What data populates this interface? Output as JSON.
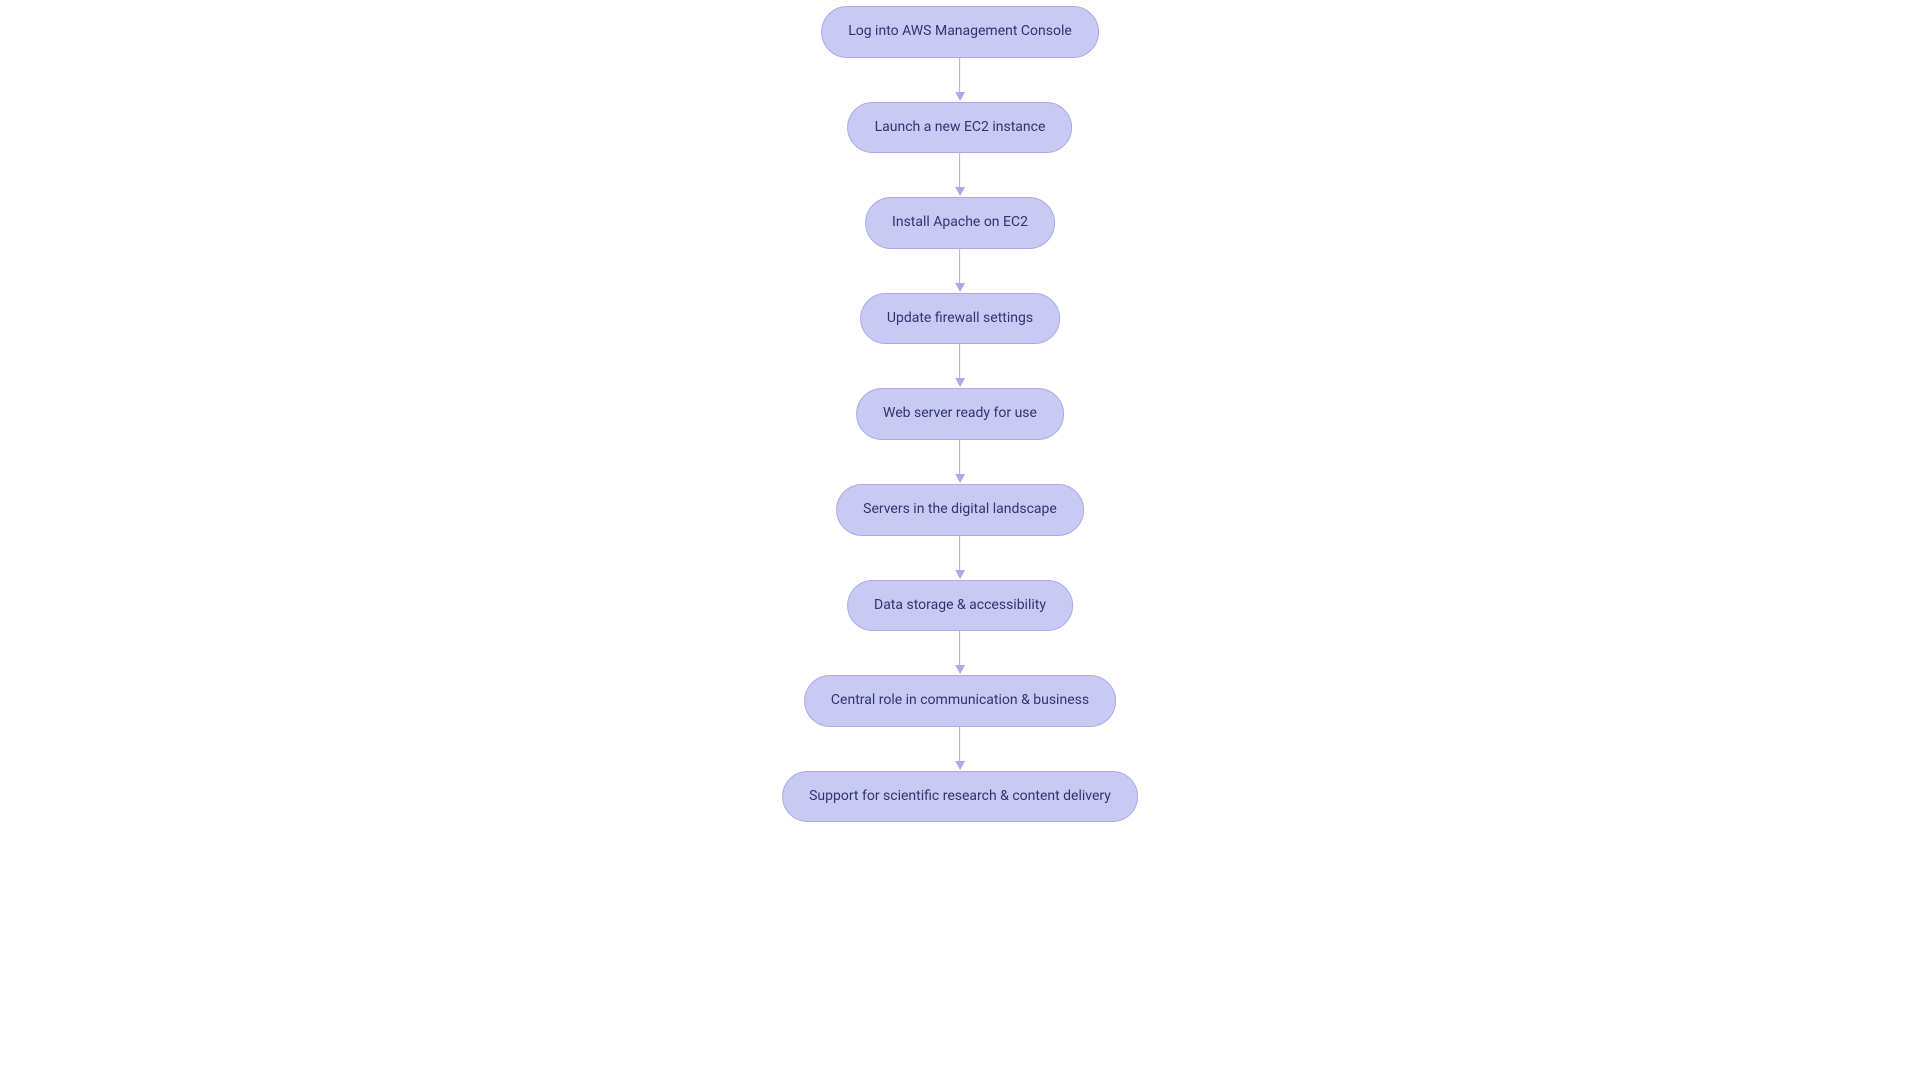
{
  "flowchart": {
    "nodes": [
      {
        "label": "Log into AWS Management Console"
      },
      {
        "label": "Launch a new EC2 instance"
      },
      {
        "label": "Install Apache on EC2"
      },
      {
        "label": "Update firewall settings"
      },
      {
        "label": "Web server ready for use"
      },
      {
        "label": "Servers in the digital landscape"
      },
      {
        "label": "Data storage & accessibility"
      },
      {
        "label": "Central role in communication & business"
      },
      {
        "label": "Support for scientific research & content delivery"
      }
    ]
  }
}
